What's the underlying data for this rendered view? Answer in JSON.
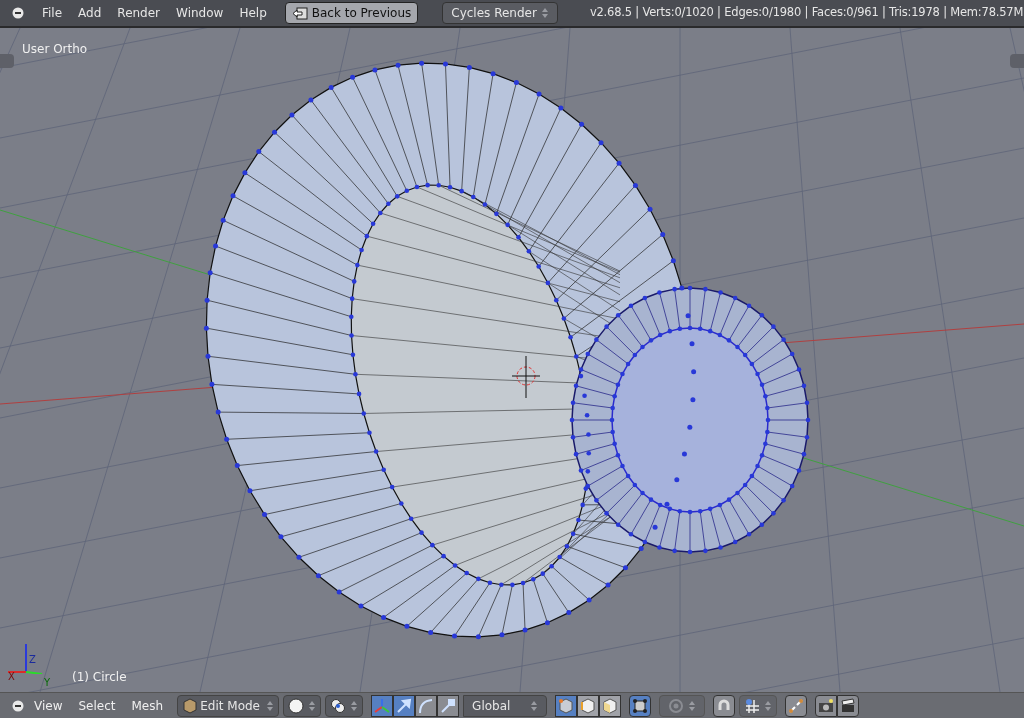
{
  "top_bar": {
    "menu": [
      "File",
      "Add",
      "Render",
      "Window",
      "Help"
    ],
    "back_button": "Back to Previous",
    "render_engine": "Cycles Render",
    "stats": "v2.68.5 | Verts:0/1020 | Edges:0/1980 | Faces:0/961 | Tris:1978 | Mem:78.57M"
  },
  "viewport": {
    "view_label": "User Ortho",
    "object_label": "(1) Circle",
    "axes": [
      "Z",
      "X",
      "Y"
    ]
  },
  "bottom_bar": {
    "menu": [
      "View",
      "Select",
      "Mesh"
    ],
    "mode": "Edit Mode",
    "manipulators": [
      {
        "kind": "axes",
        "selected": true
      },
      {
        "kind": "translate",
        "selected": true
      },
      {
        "kind": "rotate",
        "selected": false
      },
      {
        "kind": "scale",
        "selected": false
      }
    ],
    "orientation": "Global",
    "select_modes": [
      {
        "kind": "vertex",
        "selected": true
      },
      {
        "kind": "edge",
        "selected": false
      },
      {
        "kind": "face",
        "selected": false
      }
    ],
    "limit_to_visible": true,
    "snap": false
  }
}
